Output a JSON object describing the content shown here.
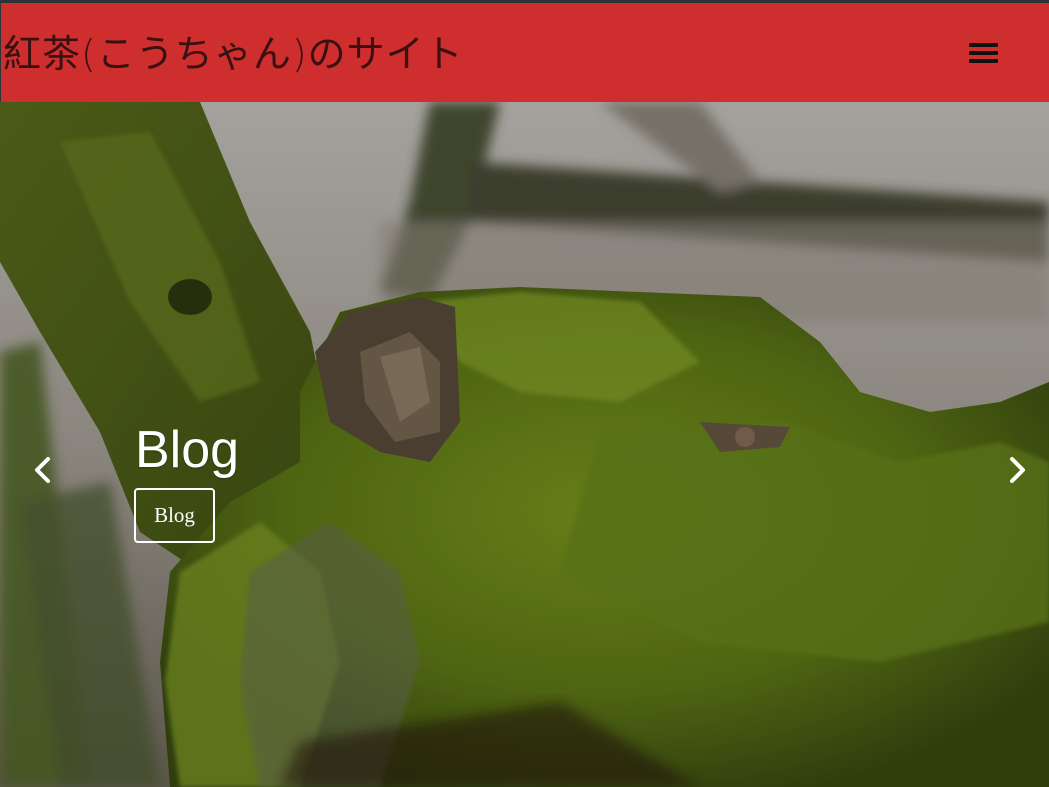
{
  "header": {
    "site_title": "紅茶(こうちゃん)のサイト",
    "menu_icon": "hamburger-menu-icon",
    "background_color": "#cf2e2e"
  },
  "carousel": {
    "slide_title": "Blog",
    "slide_button_label": "Blog",
    "prev_icon": "chevron-left-icon",
    "next_icon": "chevron-right-icon",
    "image_description_icon": "moss-covered-tree-branch-photo"
  }
}
